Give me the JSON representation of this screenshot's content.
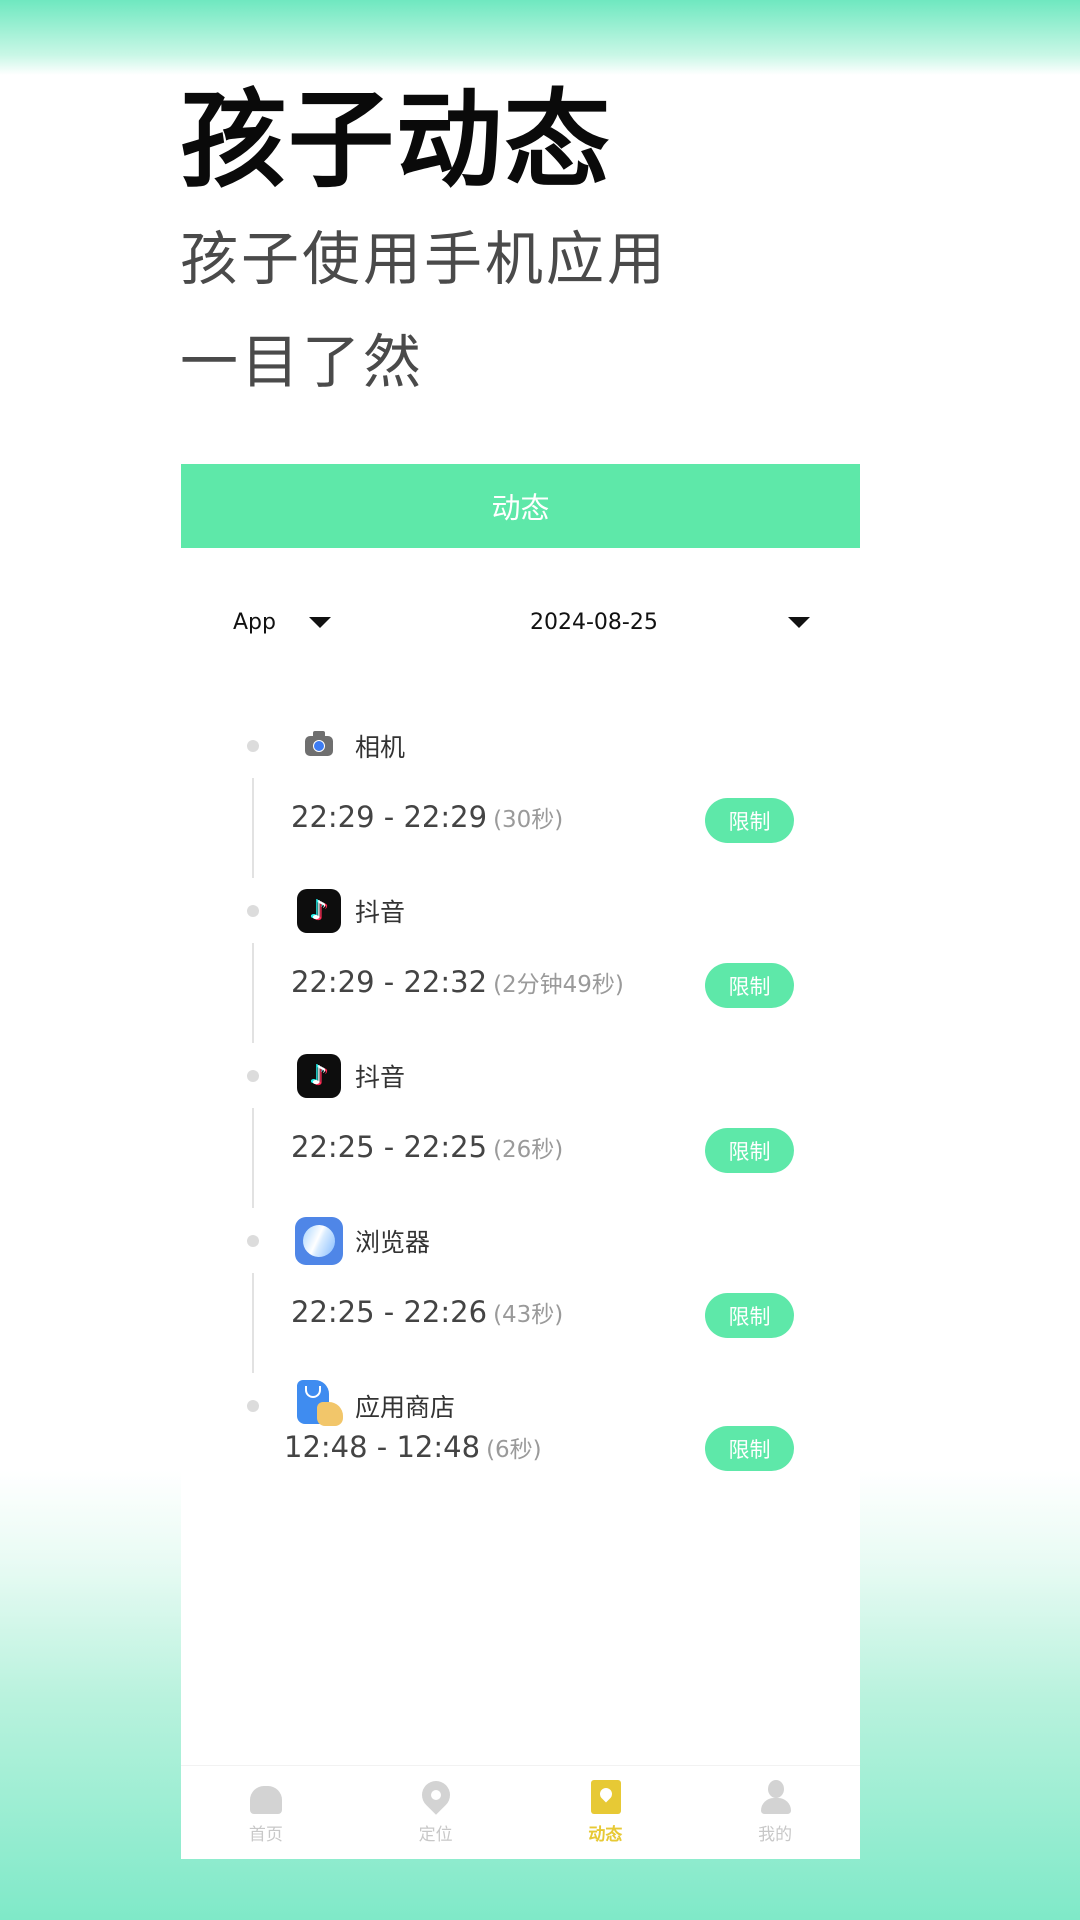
{
  "hero": {
    "title": "孩子动态",
    "subtitle_line1": "孩子使用手机应用",
    "subtitle_line2": "一目了然"
  },
  "header": {
    "title": "动态",
    "color": "#5ee8a9"
  },
  "filters": {
    "type_value": "App",
    "date_value": "2024-08-25"
  },
  "activities": [
    {
      "app": "相机",
      "icon": "camera-icon",
      "time": "22:29 - 22:29",
      "duration": "(30秒)",
      "action": "限制"
    },
    {
      "app": "抖音",
      "icon": "douyin-icon",
      "icon_glyph": "♪",
      "time": "22:29 - 22:32",
      "duration": "(2分钟49秒)",
      "action": "限制"
    },
    {
      "app": "抖音",
      "icon": "douyin-icon",
      "icon_glyph": "♪",
      "time": "22:25 - 22:25",
      "duration": "(26秒)",
      "action": "限制"
    },
    {
      "app": "浏览器",
      "icon": "browser-icon",
      "time": "22:25 - 22:26",
      "duration": "(43秒)",
      "action": "限制"
    },
    {
      "app": "应用商店",
      "icon": "app-store-icon",
      "time": "12:48 - 12:48",
      "duration": "(6秒)",
      "action": "限制"
    }
  ],
  "tabbar": {
    "items": [
      {
        "label": "首页",
        "icon": "home-icon",
        "active": false
      },
      {
        "label": "定位",
        "icon": "location-pin-icon",
        "active": false
      },
      {
        "label": "动态",
        "icon": "activity-icon",
        "active": true
      },
      {
        "label": "我的",
        "icon": "user-icon",
        "active": false
      }
    ],
    "active_color": "#e7c935",
    "inactive_color": "#c8c8c8"
  }
}
